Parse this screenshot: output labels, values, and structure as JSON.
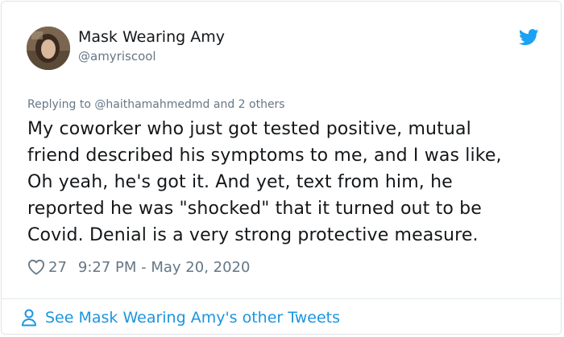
{
  "author": {
    "display_name": "Mask Wearing Amy",
    "handle": "@amyriscool",
    "avatar_icon": "user-avatar-photo"
  },
  "brand": {
    "icon": "twitter-bird-icon",
    "color": "#1da1f2"
  },
  "reply": {
    "text": "Replying to @haithamahmedmd and 2 others"
  },
  "tweet": {
    "lines": [
      "My coworker who just got tested positive, mutual",
      "friend described his symptoms to me, and I was like,",
      "Oh yeah, he's got it.  And yet, text from him, he",
      "reported he was \"shocked\" that it turned out to be",
      "Covid.  Denial is a very strong protective measure."
    ]
  },
  "meta": {
    "like_icon": "heart-outline-icon",
    "like_count": "27",
    "timestamp": "9:27 PM - May 20, 2020"
  },
  "footer": {
    "icon": "person-outline-icon",
    "link_text": "See Mask Wearing Amy's other Tweets",
    "link_color": "#1b95e0"
  }
}
